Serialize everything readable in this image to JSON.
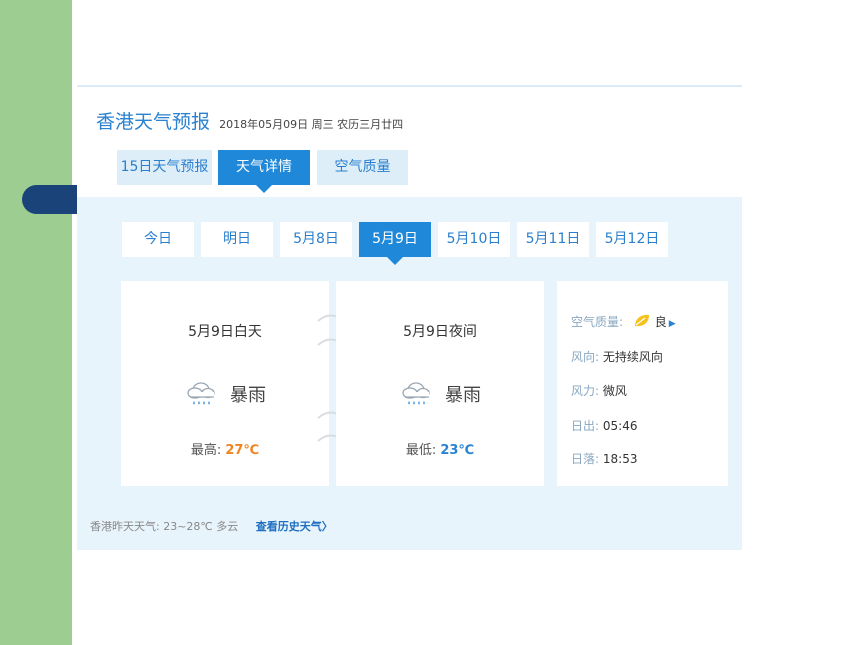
{
  "header": {
    "title": "香港天气预报",
    "date": "2018年05月09日 周三 农历三月廿四"
  },
  "tabs": [
    {
      "label": "15日天气预报",
      "active": false
    },
    {
      "label": "天气详情",
      "active": true
    },
    {
      "label": "空气质量",
      "active": false
    }
  ],
  "days": [
    {
      "label": "今日",
      "active": false
    },
    {
      "label": "明日",
      "active": false
    },
    {
      "label": "5月8日",
      "active": false
    },
    {
      "label": "5月9日",
      "active": true
    },
    {
      "label": "5月10日",
      "active": false
    },
    {
      "label": "5月11日",
      "active": false
    },
    {
      "label": "5月12日",
      "active": false
    }
  ],
  "day_card": {
    "title": "5月9日白天",
    "weather_icon": "heavy-rain-icon",
    "weather": "暴雨",
    "temp_label": "最高:",
    "temp_value": "27℃"
  },
  "night_card": {
    "title": "5月9日夜间",
    "weather_icon": "heavy-rain-icon",
    "weather": "暴雨",
    "temp_label": "最低:",
    "temp_value": "23℃"
  },
  "info": {
    "air_quality_label": "空气质量:",
    "air_quality_value": "良",
    "air_quality_icon": "leaf-icon",
    "wind_dir_label": "风向:",
    "wind_dir_value": "无持续风向",
    "wind_force_label": "风力:",
    "wind_force_value": "微风",
    "sunrise_label": "日出:",
    "sunrise_value": "05:46",
    "sunset_label": "日落:",
    "sunset_value": "18:53"
  },
  "footer": {
    "yesterday": "香港昨天天气: 23~28℃ 多云",
    "history_link": "查看历史天气〉"
  },
  "colors": {
    "accent": "#2088d8",
    "panel_bg": "#e8f4fc",
    "high_temp": "#f0841f",
    "side_band": "#9ecd92",
    "pill": "#1a4479"
  }
}
